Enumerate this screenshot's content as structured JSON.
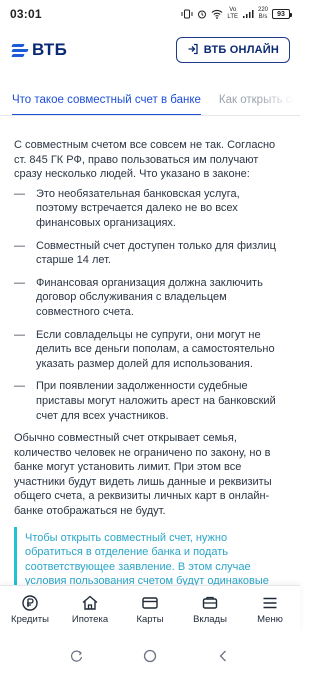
{
  "status": {
    "time": "03:01",
    "network_label": "Vo\nLTE",
    "speed_top": "220",
    "speed_bottom": "B/s",
    "battery": "93"
  },
  "header": {
    "logo_text": "ВТБ",
    "online_button": "ВТБ ОНЛАЙН"
  },
  "tabs": [
    {
      "label": "Что такое совместный счет в банке",
      "active": true
    },
    {
      "label": "Как открыть совместный счет",
      "active": false
    }
  ],
  "content": {
    "intro": "С совместным счетом все совсем не так. Согласно ст. 845 ГК РФ, право пользоваться им получают сразу несколько людей. Что указано в законе:",
    "bullets": [
      "Это необязательная банковская услуга, поэтому встречается далеко не во всех финансовых организациях.",
      "Совместный счет доступен только для физлиц старше 14 лет.",
      "Финансовая организация должна заключить договор обслуживания с владельцем совместного счета.",
      "Если совладельцы не супруги, они могут не делить все деньги пополам, а самостоятельно указать размер долей для использования.",
      "При появлении задолженности судебные приставы могут наложить арест на банковский счет для всех участников."
    ],
    "bullet_dash": "—",
    "paragraph2": "Обычно совместный счет открывает семья, количество человек не ограничено по закону, но в банке могут установить лимит. При этом все участники будут видеть лишь данные и реквизиты общего счета, а реквизиты личных карт в онлайн-банке отображаться не будут.",
    "quote": "Чтобы открыть совместный счет, нужно обратиться в отделение банка и подать соответствующее заявление. В этом случае условия пользования счетом будут одинаковые для всех. Бюджет тоже общий. Исключение — если между мужем и женой заключен брачный договор. В этом случае финансовые права и"
  },
  "bottom_nav": [
    {
      "label": "Кредиты",
      "icon": "credit-icon"
    },
    {
      "label": "Ипотека",
      "icon": "house-icon"
    },
    {
      "label": "Карты",
      "icon": "card-icon"
    },
    {
      "label": "Вклады",
      "icon": "deposit-icon"
    },
    {
      "label": "Меню",
      "icon": "menu-icon"
    }
  ],
  "colors": {
    "brand": "#0a2973",
    "accent": "#1d4ed8",
    "quote": "#2aa5c9"
  }
}
